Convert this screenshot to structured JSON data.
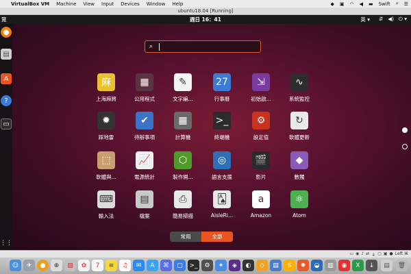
{
  "mac_menubar": {
    "app_name": "VirtualBox VM",
    "menus": [
      "Machine",
      "View",
      "Input",
      "Devices",
      "Window",
      "Help"
    ],
    "user": "Swift"
  },
  "vm_window": {
    "title": "ubuntu18.04 [Running]"
  },
  "ubuntu_topbar": {
    "activities": "覽",
    "clock": "週日 16：41",
    "input_method": "英 ▾"
  },
  "search": {
    "value": ""
  },
  "apps": [
    {
      "label": "上海麻將",
      "icon": "mahjong-icon",
      "color": "#e8c030",
      "glyph": "麻"
    },
    {
      "label": "公用程式",
      "icon": "utilities-folder-icon",
      "color": "#5a3440",
      "glyph": "▦"
    },
    {
      "label": "文字編...",
      "icon": "text-editor-icon",
      "color": "#f3f3f3",
      "glyph": "✎"
    },
    {
      "label": "行事曆",
      "icon": "calendar-icon",
      "color": "#3a7bd5",
      "glyph": "27"
    },
    {
      "label": "初始啟...",
      "icon": "startup-disk-icon",
      "color": "#7a3aa0",
      "glyph": "⇲"
    },
    {
      "label": "系統監控",
      "icon": "system-monitor-icon",
      "color": "#2d2d2d",
      "glyph": "∿"
    },
    {
      "label": "踩地雷",
      "icon": "mines-icon",
      "color": "#333333",
      "glyph": "✹"
    },
    {
      "label": "待辦事項",
      "icon": "todo-icon",
      "color": "#3b73c8",
      "glyph": "✔"
    },
    {
      "label": "計算機",
      "icon": "calculator-icon",
      "color": "#6a6a6a",
      "glyph": "▦"
    },
    {
      "label": "終端機",
      "icon": "terminal-icon",
      "color": "#2c2c2c",
      "glyph": ">_"
    },
    {
      "label": "設定值",
      "icon": "settings-icon",
      "color": "#c8321e",
      "glyph": "⚙"
    },
    {
      "label": "軟體更新",
      "icon": "software-updater-icon",
      "color": "#e9e9e9",
      "glyph": "↻"
    },
    {
      "label": "軟體與...",
      "icon": "software-sources-icon",
      "color": "#c8a070",
      "glyph": "⬚"
    },
    {
      "label": "電源統計",
      "icon": "power-statistics-icon",
      "color": "#f0f0f0",
      "glyph": "📈"
    },
    {
      "label": "製作開...",
      "icon": "startup-creator-icon",
      "color": "#4e9a2a",
      "glyph": "⬡"
    },
    {
      "label": "語言支援",
      "icon": "language-support-icon",
      "color": "#2f6fb8",
      "glyph": "◎"
    },
    {
      "label": "影片",
      "icon": "videos-icon",
      "color": "#2a2a2a",
      "glyph": "🎬"
    },
    {
      "label": "數獨",
      "icon": "sudoku-icon",
      "color": "#8a5ab8",
      "glyph": "◆"
    },
    {
      "label": "輸入法",
      "icon": "input-method-icon",
      "color": "#dcdcdc",
      "glyph": "⌨"
    },
    {
      "label": "檔案",
      "icon": "files-icon",
      "color": "#c9c9c9",
      "glyph": "▤"
    },
    {
      "label": "簡易掃描",
      "icon": "simple-scan-icon",
      "color": "#e8e8e8",
      "glyph": "⎙"
    },
    {
      "label": "AisleRi...",
      "icon": "aisleriot-cards-icon",
      "color": "#e8e8e8",
      "glyph": "🂡"
    },
    {
      "label": "Amazon",
      "icon": "amazon-icon",
      "color": "#ffffff",
      "glyph": "a"
    },
    {
      "label": "Atom",
      "icon": "atom-icon",
      "color": "#4caf50",
      "glyph": "⚛"
    }
  ],
  "view_toggle": {
    "frequent": "常用",
    "all": "全部"
  },
  "vm_statusbar": {
    "host_key": "Left ⌘"
  }
}
